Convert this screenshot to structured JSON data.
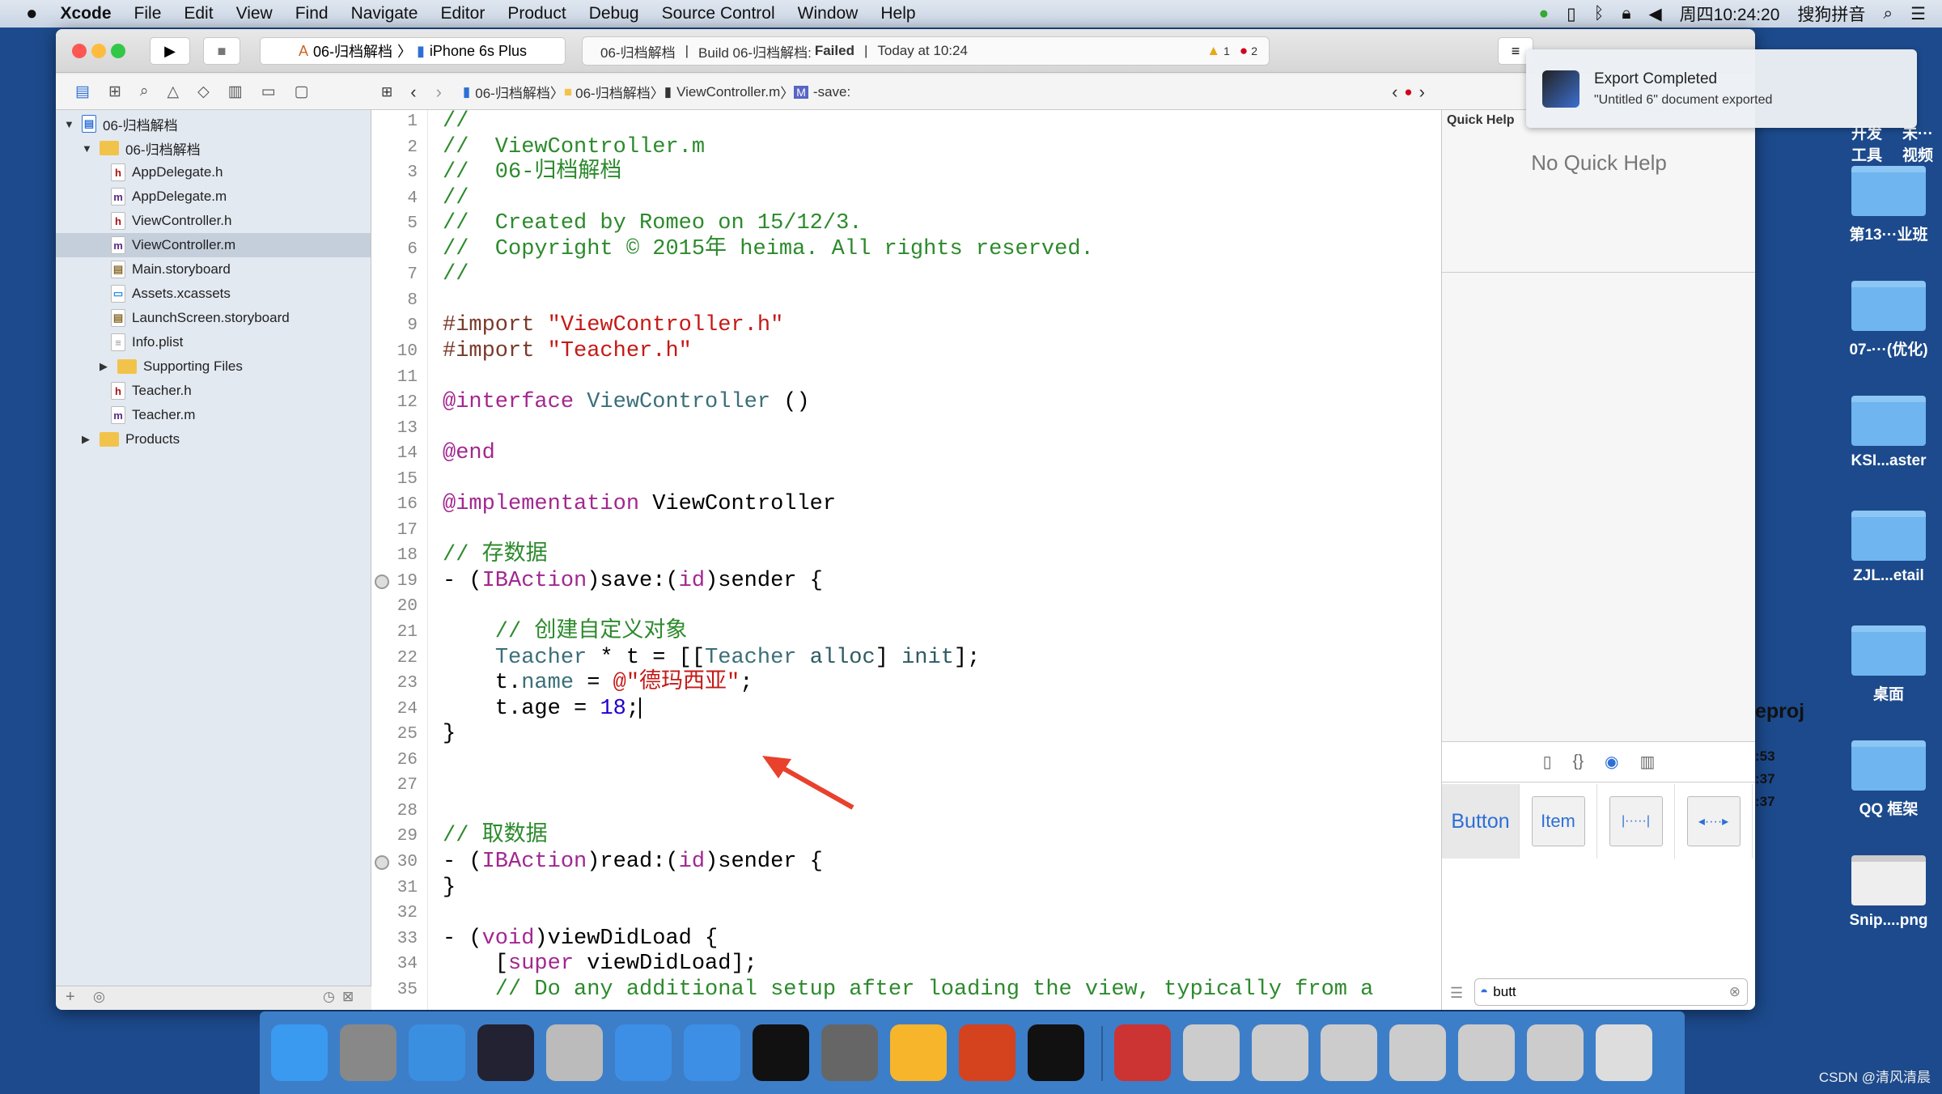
{
  "menubar": {
    "apple": "",
    "app": "Xcode",
    "items": [
      "File",
      "Edit",
      "View",
      "Find",
      "Navigate",
      "Editor",
      "Product",
      "Debug",
      "Source Control",
      "Window",
      "Help"
    ],
    "clock": "周四10:24:20",
    "ime": "搜狗拼音"
  },
  "toolbar": {
    "scheme": "06-归档解档",
    "device": "iPhone 6s Plus",
    "activity": {
      "project": "06-归档解档",
      "build": "Build 06-归档解档:",
      "status": "Failed",
      "time": "Today at 10:24",
      "warnings": "1",
      "errors": "2"
    }
  },
  "jumpbar": {
    "items": [
      "06-归档解档",
      "06-归档解档",
      "ViewController.m",
      "-save:"
    ]
  },
  "navigator": {
    "items": [
      {
        "label": "06-归档解档",
        "kind": "project",
        "level": 0,
        "open": true
      },
      {
        "label": "06-归档解档",
        "kind": "folder",
        "level": 1,
        "open": true
      },
      {
        "label": "AppDelegate.h",
        "kind": "h",
        "level": 2
      },
      {
        "label": "AppDelegate.m",
        "kind": "m",
        "level": 2
      },
      {
        "label": "ViewController.h",
        "kind": "h",
        "level": 2
      },
      {
        "label": "ViewController.m",
        "kind": "m",
        "level": 2,
        "selected": true
      },
      {
        "label": "Main.storyboard",
        "kind": "sb",
        "level": 2
      },
      {
        "label": "Assets.xcassets",
        "kind": "assets",
        "level": 2
      },
      {
        "label": "LaunchScreen.storyboard",
        "kind": "sb",
        "level": 2
      },
      {
        "label": "Info.plist",
        "kind": "plist",
        "level": 2
      },
      {
        "label": "Supporting Files",
        "kind": "folder",
        "level": 2,
        "open": false
      },
      {
        "label": "Teacher.h",
        "kind": "h",
        "level": 2
      },
      {
        "label": "Teacher.m",
        "kind": "m",
        "level": 2
      },
      {
        "label": "Products",
        "kind": "folder",
        "level": 1,
        "open": false
      }
    ]
  },
  "editor": {
    "breakpoints": [
      19,
      30
    ],
    "cursor_line": 24,
    "lines": [
      [
        [
          "c",
          "//"
        ]
      ],
      [
        [
          "c",
          "//  ViewController.m"
        ]
      ],
      [
        [
          "c",
          "//  06-归档解档"
        ]
      ],
      [
        [
          "c",
          "//"
        ]
      ],
      [
        [
          "c",
          "//  Created by Romeo on 15/12/3."
        ]
      ],
      [
        [
          "c",
          "//  Copyright © 2015年 heima. All rights reserved."
        ]
      ],
      [
        [
          "c",
          "//"
        ]
      ],
      [],
      [
        [
          "p",
          "#import "
        ],
        [
          "s",
          "\"ViewController.h\""
        ]
      ],
      [
        [
          "p",
          "#import "
        ],
        [
          "s",
          "\"Teacher.h\""
        ]
      ],
      [],
      [
        [
          "k",
          "@interface "
        ],
        [
          "t",
          "ViewController"
        ],
        [
          "n",
          " ()"
        ]
      ],
      [],
      [
        [
          "k",
          "@end"
        ]
      ],
      [],
      [
        [
          "k",
          "@implementation "
        ],
        [
          "n",
          "ViewController"
        ]
      ],
      [],
      [
        [
          "c",
          "// 存数据"
        ]
      ],
      [
        [
          "n",
          "- ("
        ],
        [
          "k",
          "IBAction"
        ],
        [
          "n",
          ")save:("
        ],
        [
          "k",
          "id"
        ],
        [
          "n",
          ")sender {"
        ]
      ],
      [],
      [
        [
          "c",
          "    // 创建自定义对象"
        ]
      ],
      [
        [
          "n",
          "    "
        ],
        [
          "t",
          "Teacher"
        ],
        [
          "n",
          " * t = [["
        ],
        [
          "t",
          "Teacher"
        ],
        [
          "n",
          " "
        ],
        [
          "m",
          "alloc"
        ],
        [
          "n",
          "] "
        ],
        [
          "m",
          "init"
        ],
        [
          "n",
          "];"
        ]
      ],
      [
        [
          "n",
          "    t."
        ],
        [
          "t",
          "name"
        ],
        [
          "n",
          " = "
        ],
        [
          "s",
          "@\"德玛西亚\""
        ],
        [
          "n",
          ";"
        ]
      ],
      [
        [
          "n",
          "    t.age = "
        ],
        [
          "num",
          "18"
        ],
        [
          "n",
          ";"
        ]
      ],
      [
        [
          "n",
          "}"
        ]
      ],
      [],
      [],
      [],
      [
        [
          "c",
          "// 取数据"
        ]
      ],
      [
        [
          "n",
          "- ("
        ],
        [
          "k",
          "IBAction"
        ],
        [
          "n",
          ")read:("
        ],
        [
          "k",
          "id"
        ],
        [
          "n",
          ")sender {"
        ]
      ],
      [
        [
          "n",
          "}"
        ]
      ],
      [],
      [
        [
          "n",
          "- ("
        ],
        [
          "k",
          "void"
        ],
        [
          "n",
          ")viewDidLoad {"
        ]
      ],
      [
        [
          "n",
          "    ["
        ],
        [
          "k",
          "super"
        ],
        [
          "n",
          " viewDidLoad];"
        ]
      ],
      [
        [
          "c",
          "    // Do any additional setup after loading the view, typically from a"
        ]
      ]
    ]
  },
  "quickhelp": {
    "title": "Quick Help",
    "empty": "No Quick Help"
  },
  "library": {
    "items": [
      "Button",
      "Item",
      "",
      ""
    ],
    "filter": "butt"
  },
  "notification": {
    "title": "Export Completed",
    "body": "\"Untitled 6\" document exported"
  },
  "desktop": {
    "tags": [
      "开发工具",
      "未···视频"
    ],
    "items": [
      "第13···业班",
      "07-···(优化)",
      "KSI...aster",
      "ZJL...etail",
      "桌面",
      "QQ 框架",
      "Snip....png"
    ],
    "behind": [
      "eproj",
      ":53",
      ":37",
      ":37"
    ]
  },
  "watermark": "CSDN @清风清晨",
  "colors": {
    "desktop": "#1c4a8c",
    "error": "#d0021b",
    "arrow": "#e8412c",
    "accent": "#2d6fd6"
  }
}
